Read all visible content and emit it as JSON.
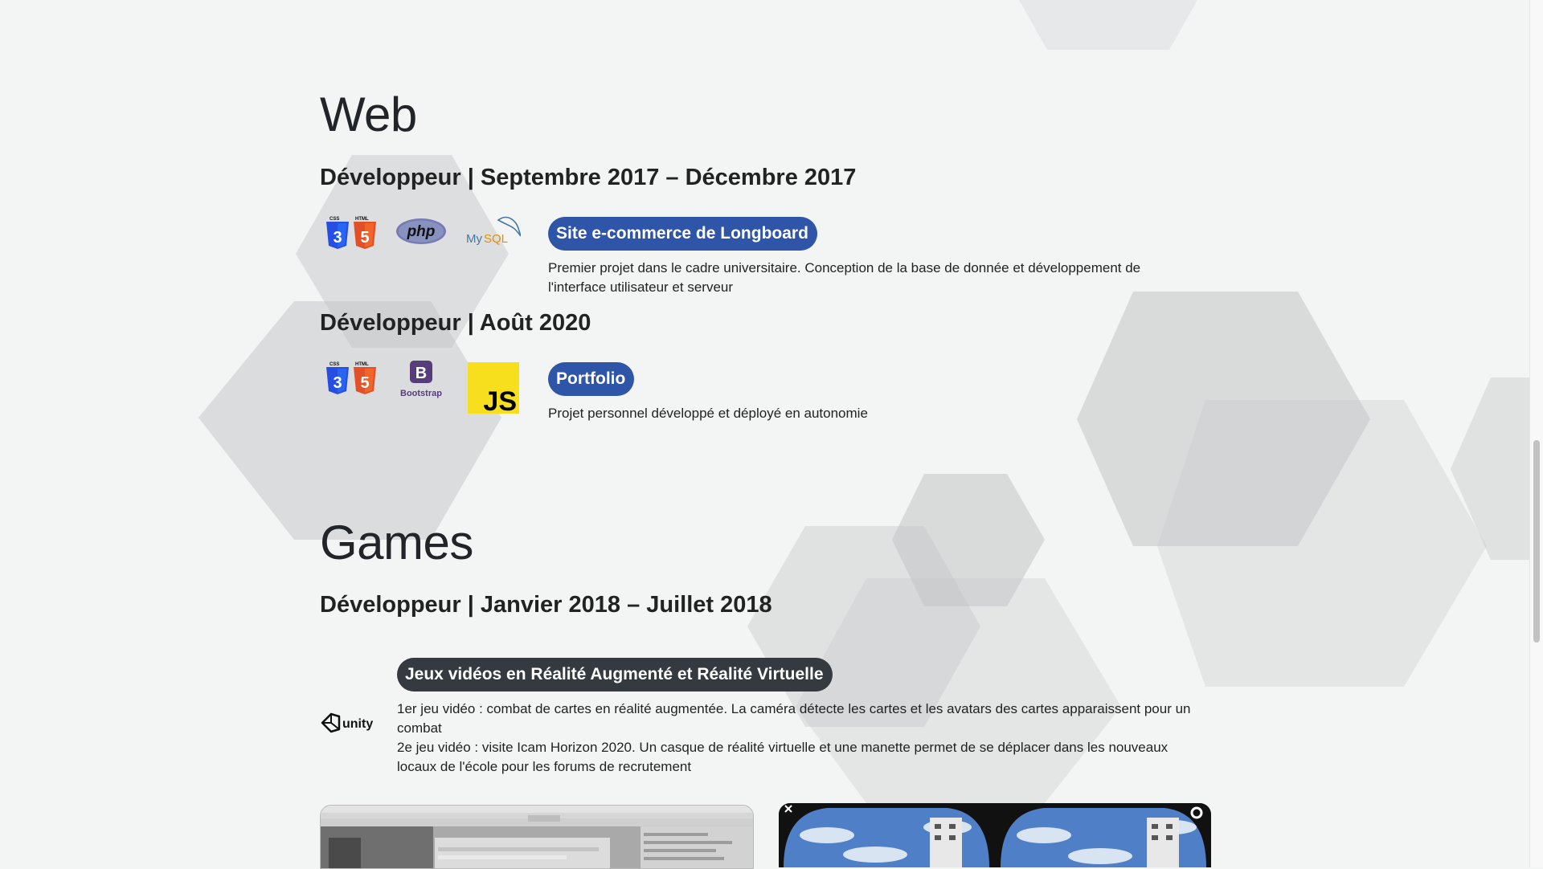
{
  "sections": {
    "web": {
      "title": "Web",
      "jobs": [
        {
          "title": "Développeur | Septembre 2017 – Décembre 2017",
          "logos": [
            "css3-html5-logo",
            "php-logo",
            "mysql-logo"
          ],
          "project": "Site e-commerce de Longboard",
          "description": "Premier projet dans le cadre universitaire. Conception de la base de donnée et développement de l'interface utilisateur et serveur"
        },
        {
          "title": "Développeur | Août 2020",
          "logos": [
            "css3-html5-logo",
            "bootstrap-logo",
            "javascript-logo"
          ],
          "project": "Portfolio",
          "description": "Projet personnel développé et déployé en autonomie"
        }
      ]
    },
    "games": {
      "title": "Games",
      "jobs": [
        {
          "title": "Développeur | Janvier 2018 – Juillet 2018",
          "logos": [
            "unity-logo"
          ],
          "project": "Jeux vidéos en Réalité Augmenté et Réalité Virtuelle",
          "description_1": "1er jeu vidéo : combat de cartes en réalité augmentée. La caméra détecte les cartes et les avatars des cartes apparaissent pour un combat",
          "description_2": "2e jeu vidéo : visite Icam Horizon 2020. Un casque de réalité virtuelle et une manette permet de se déplacer dans les nouveaux locaux de l'école pour les forums de recrutement",
          "screenshots": [
            "unity-editor-screenshot",
            "vr-headset-view-screenshot"
          ]
        }
      ]
    }
  },
  "logo_text": {
    "css": "CSS",
    "html": "HTML",
    "php": "php",
    "mysql_my": "My",
    "mysql_sql": "SQL",
    "bootstrap_letter": "B",
    "bootstrap": "Bootstrap",
    "js": "JS",
    "unity": "unity"
  },
  "colors": {
    "background": "#f3f5f4",
    "badge_blue": "#2f55a8",
    "badge_dark": "#343a40",
    "hexagon": "#c4c6c8"
  }
}
